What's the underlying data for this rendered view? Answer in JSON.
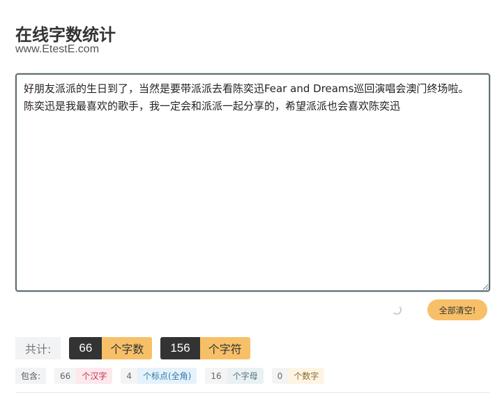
{
  "header": {
    "title": "在线字数统计",
    "subtitle": "www.EtestE.com"
  },
  "editor": {
    "value": "好朋友派派的生日到了，当然是要带派派去看陈奕迅Fear and Dreams巡回演唱会澳门终场啦。\n陈奕迅是我最喜欢的歌手，我一定会和派派一起分享的，希望派派也会喜欢陈奕迅"
  },
  "actions": {
    "clear_label": "全部清空!"
  },
  "totals": {
    "label": "共计:",
    "chars_count": "66",
    "chars_unit": "个字数",
    "symbols_count": "156",
    "symbols_unit": "个字符"
  },
  "details": {
    "label": "包含:",
    "hanzi_count": "66",
    "hanzi_unit": "个汉字",
    "punct_count": "4",
    "punct_unit": "个标点(全角)",
    "letter_count": "16",
    "letter_unit": "个字母",
    "digit_count": "0",
    "digit_unit": "个数字"
  },
  "colors": {
    "accent": "#f7c068",
    "dark": "#333333",
    "editor_border": "#5a6c71"
  }
}
